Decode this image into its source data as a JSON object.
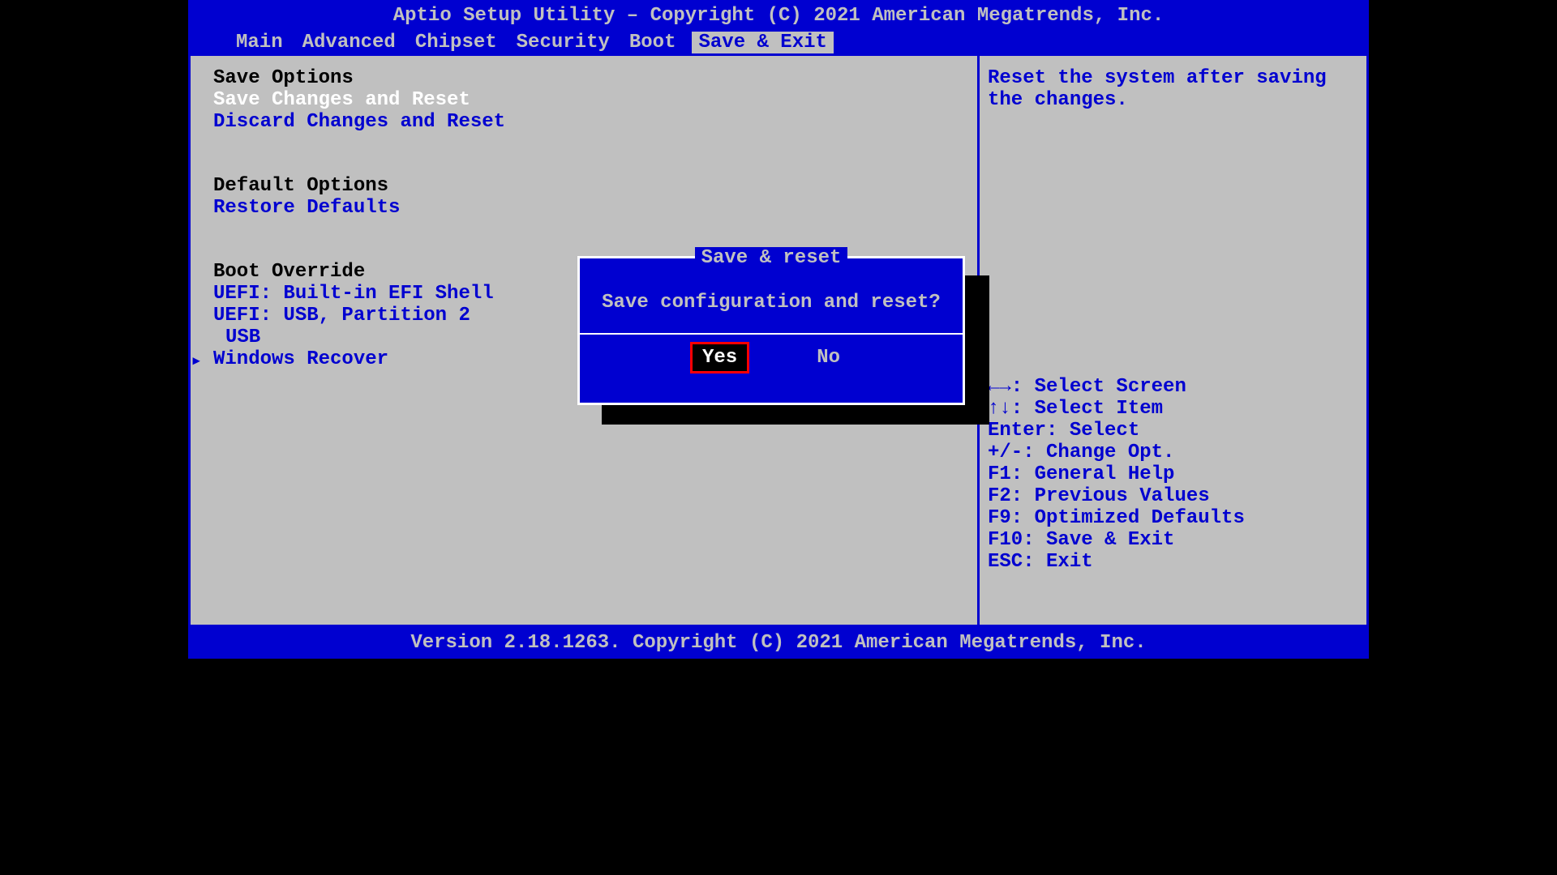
{
  "header": {
    "title": "Aptio Setup Utility – Copyright (C) 2021 American Megatrends, Inc."
  },
  "tabs": [
    {
      "label": "Main"
    },
    {
      "label": "Advanced"
    },
    {
      "label": "Chipset"
    },
    {
      "label": "Security"
    },
    {
      "label": "Boot"
    },
    {
      "label": "Save & Exit",
      "active": true
    }
  ],
  "sections": {
    "save_options": {
      "header": "Save Options",
      "items": [
        "Save Changes and Reset",
        "Discard Changes and Reset"
      ]
    },
    "default_options": {
      "header": "Default Options",
      "items": [
        "Restore Defaults"
      ]
    },
    "boot_override": {
      "header": "Boot Override",
      "items": [
        "UEFI: Built-in EFI Shell",
        "UEFI:  USB, Partition 2",
        " USB",
        "Windows Recover"
      ]
    }
  },
  "help": {
    "text": "Reset the system after saving the changes."
  },
  "keys": [
    "←→: Select Screen",
    "↑↓: Select Item",
    "Enter: Select",
    "+/-: Change Opt.",
    "F1: General Help",
    "F2: Previous Values",
    "F9: Optimized Defaults",
    "F10: Save & Exit",
    "ESC: Exit"
  ],
  "footer": {
    "text": "Version 2.18.1263. Copyright (C) 2021 American Megatrends, Inc."
  },
  "dialog": {
    "title": "Save & reset",
    "message": "Save configuration and reset?",
    "yes": "Yes",
    "no": "No"
  }
}
